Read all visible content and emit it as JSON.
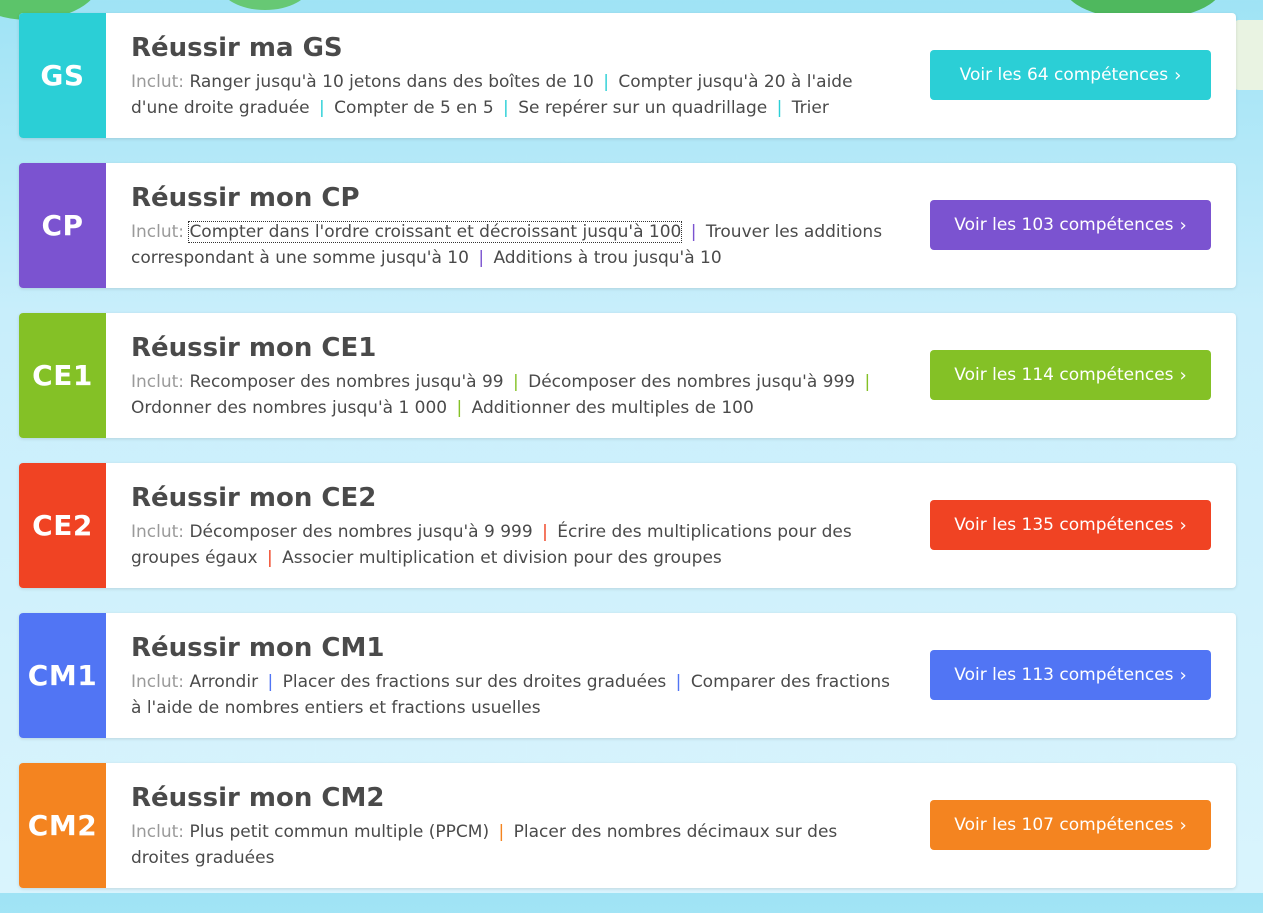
{
  "includes_label": "Inclut:",
  "cards": [
    {
      "badge": "GS",
      "color": "#2bcfd6",
      "title": "Réussir ma GS",
      "skills": [
        "Ranger jusqu'à 10 jetons dans des boîtes de 10",
        "Compter jusqu'à 20 à l'aide d'une droite graduée",
        "Compter de 5 en 5",
        "Se repérer sur un quadrillage",
        "Trier"
      ],
      "button": "Voir les 64 compétences",
      "chevron": "›"
    },
    {
      "badge": "CP",
      "color": "#7b53d0",
      "title": "Réussir mon CP",
      "skills": [
        "Compter dans l'ordre croissant et décroissant jusqu'à 100",
        "Trouver les additions correspondant à une somme jusqu'à 10",
        "Additions à trou jusqu'à 10"
      ],
      "button": "Voir les 103 compétences",
      "chevron": "›"
    },
    {
      "badge": "CE1",
      "color": "#84c126",
      "title": "Réussir mon CE1",
      "skills": [
        "Recomposer des nombres jusqu'à 99",
        "Décomposer des nombres jusqu'à 999",
        "Ordonner des nombres jusqu'à 1 000",
        "Additionner des multiples de 100"
      ],
      "button": "Voir les 114 compétences",
      "chevron": "›"
    },
    {
      "badge": "CE2",
      "color": "#f04323",
      "title": "Réussir mon CE2",
      "skills": [
        "Décomposer des nombres jusqu'à 9 999",
        "Écrire des multiplications pour des groupes égaux",
        "Associer multiplication et division pour des groupes"
      ],
      "button": "Voir les 135 compétences",
      "chevron": "›"
    },
    {
      "badge": "CM1",
      "color": "#5175f4",
      "title": "Réussir mon CM1",
      "skills": [
        "Arrondir",
        "Placer des fractions sur des droites graduées",
        "Comparer des fractions à l'aide de nombres entiers et fractions usuelles"
      ],
      "button": "Voir les 113 compétences",
      "chevron": "›"
    },
    {
      "badge": "CM2",
      "color": "#f48420",
      "title": "Réussir mon CM2",
      "skills": [
        "Plus petit commun multiple (PPCM)",
        "Placer des nombres décimaux sur des droites graduées"
      ],
      "button": "Voir les 107 compétences",
      "chevron": "›"
    }
  ]
}
